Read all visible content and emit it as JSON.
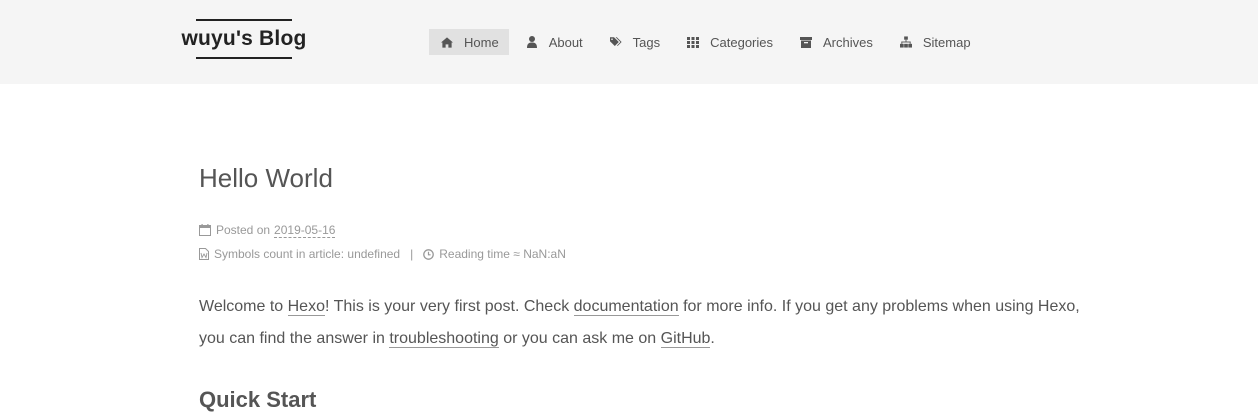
{
  "site": {
    "title": "wuyu's Blog"
  },
  "menu": [
    {
      "label": "Home",
      "icon": "home-icon",
      "active": true
    },
    {
      "label": "About",
      "icon": "user-icon",
      "active": false
    },
    {
      "label": "Tags",
      "icon": "tags-icon",
      "active": false
    },
    {
      "label": "Categories",
      "icon": "th-icon",
      "active": false
    },
    {
      "label": "Archives",
      "icon": "archive-icon",
      "active": false
    },
    {
      "label": "Sitemap",
      "icon": "sitemap-icon",
      "active": false
    }
  ],
  "post": {
    "title": "Hello World",
    "posted_on_label": "Posted on",
    "date": "2019-05-16",
    "symbols_label": "Symbols count in article: undefined",
    "separator": "|",
    "reading_time": "Reading time ≈ NaN:aN",
    "para": {
      "p1": "Welcome to ",
      "link_hexo": "Hexo",
      "p2": "! This is your very first post. Check ",
      "link_docs": "documentation",
      "p3": " for more info. If you get any problems when using Hexo, you can find the answer in ",
      "link_troubleshooting": "troubleshooting",
      "p4": " or you can ask me on ",
      "link_github": "GitHub",
      "p5": "."
    },
    "heading_quick_start": "Quick Start"
  },
  "colors": {
    "header_bg": "#f5f5f5",
    "active_menu_bg": "#e1e1e1",
    "text": "#555555",
    "meta": "#999999"
  }
}
